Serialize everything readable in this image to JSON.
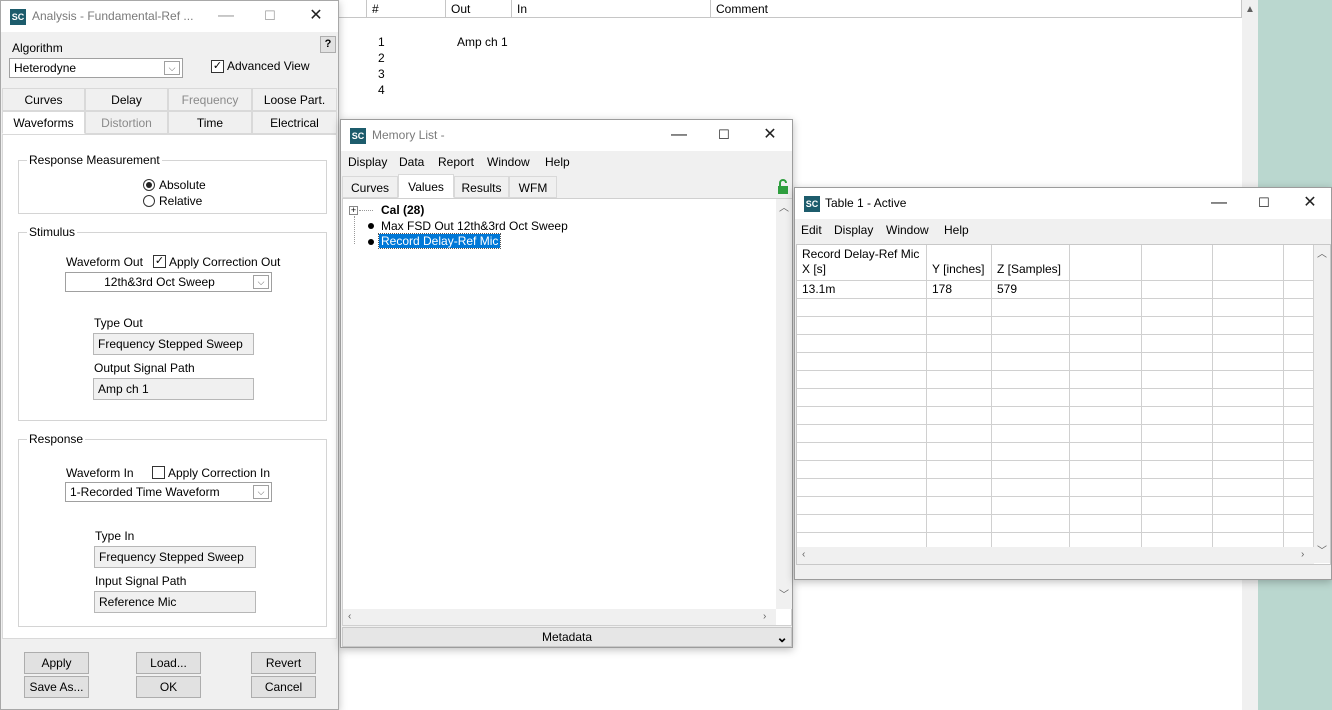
{
  "background_grid": {
    "columns": [
      "#",
      "Out",
      "In",
      "Comment"
    ],
    "rows": [
      {
        "num": "1",
        "out": "Amp ch 1"
      },
      {
        "num": "2",
        "out": ""
      },
      {
        "num": "3",
        "out": ""
      },
      {
        "num": "4",
        "out": ""
      }
    ]
  },
  "analysis": {
    "logo": "SC",
    "title": "Analysis  - Fundamental-Ref ...",
    "help": "?",
    "algorithm_label": "Algorithm",
    "algorithm_value": "Heterodyne",
    "advanced_view_label": "Advanced View",
    "advanced_view_checked": true,
    "tabs_row1": [
      "Curves",
      "Delay",
      "Frequency",
      "Loose Part."
    ],
    "tabs_row2": [
      "Waveforms",
      "Distortion",
      "Time",
      "Electrical"
    ],
    "selected_tab": "Waveforms",
    "response_measurement": {
      "title": "Response Measurement",
      "options": [
        "Absolute",
        "Relative"
      ],
      "selected": "Absolute"
    },
    "stimulus": {
      "title": "Stimulus",
      "waveform_out_label": "Waveform Out",
      "apply_correction_out_label": "Apply Correction Out",
      "apply_correction_out_checked": true,
      "waveform_out_value": "12th&3rd Oct Sweep",
      "type_out_label": "Type Out",
      "type_out_value": "Frequency Stepped Sweep",
      "output_signal_path_label": "Output Signal Path",
      "output_signal_path_value": "Amp ch 1"
    },
    "response": {
      "title": "Response",
      "waveform_in_label": "Waveform In",
      "apply_correction_in_label": "Apply Correction In",
      "apply_correction_in_checked": false,
      "waveform_in_value": "1-Recorded Time Waveform",
      "type_in_label": "Type In",
      "type_in_value": "Frequency Stepped Sweep",
      "input_signal_path_label": "Input Signal Path",
      "input_signal_path_value": "Reference Mic"
    },
    "buttons": {
      "apply": "Apply",
      "load": "Load...",
      "revert": "Revert",
      "save_as": "Save As...",
      "ok": "OK",
      "cancel": "Cancel"
    }
  },
  "memory_list": {
    "logo": "SC",
    "title": "Memory List -",
    "menu": [
      "Display",
      "Data",
      "Report",
      "Window",
      "Help"
    ],
    "tabs": [
      "Curves",
      "Values",
      "Results",
      "WFM"
    ],
    "selected_tab": "Values",
    "tree": {
      "root": "Cal (28)",
      "items": [
        "Max FSD Out 12th&3rd Oct Sweep",
        "Record Delay-Ref Mic"
      ],
      "selected": "Record Delay-Ref Mic"
    },
    "metadata_label": "Metadata",
    "lock_color": "#2e9e3e",
    "selection_color": "#0078d7"
  },
  "table": {
    "logo": "SC",
    "title": "Table 1 - Active",
    "menu": [
      "Edit",
      "Display",
      "Window",
      "Help"
    ],
    "header_group": "Record Delay-Ref Mic",
    "columns": [
      "X [s]",
      "Y [inches]",
      "Z [Samples]"
    ],
    "rows": [
      [
        "13.1m",
        "178",
        "579"
      ]
    ]
  }
}
